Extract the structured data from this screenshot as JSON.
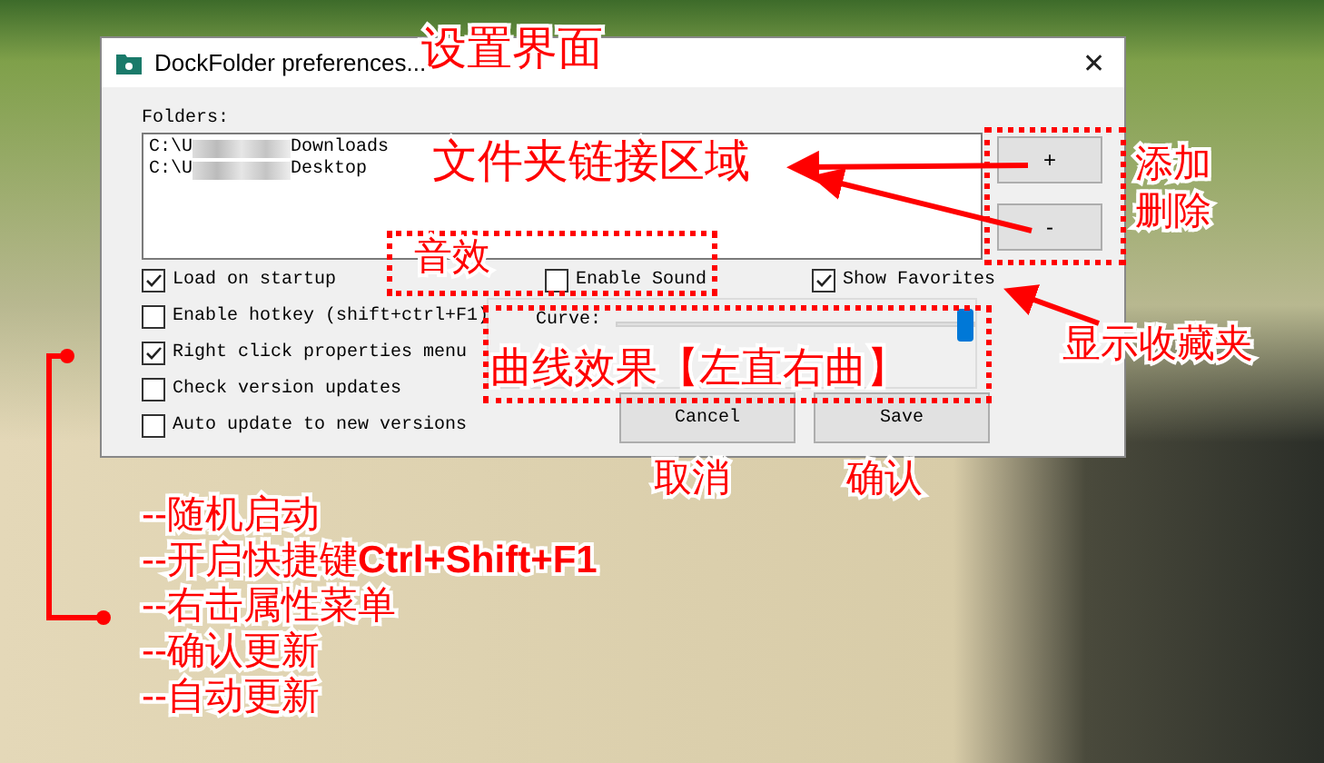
{
  "window": {
    "title": "DockFolder preferences...",
    "close": "✕"
  },
  "folders": {
    "label": "Folders:",
    "items": [
      {
        "prefix": "C:\\U",
        "name": "Downloads"
      },
      {
        "prefix": "C:\\U",
        "name": "Desktop"
      }
    ]
  },
  "side_buttons": [
    "+",
    "-"
  ],
  "options": [
    {
      "label": "Load on startup",
      "checked": true
    },
    {
      "label": "Enable hotkey (shift+ctrl+F1)",
      "checked": false
    },
    {
      "label": "Right click properties menu",
      "checked": true
    },
    {
      "label": "Check version updates",
      "checked": false
    },
    {
      "label": "Auto update to new versions",
      "checked": false
    }
  ],
  "sound": {
    "label": "Enable Sound",
    "checked": false
  },
  "favorites": {
    "label": "Show Favorites",
    "checked": true
  },
  "curve": {
    "label": "Curve:",
    "level": 1
  },
  "buttons": [
    "Cancel",
    "Save"
  ],
  "annotations": {
    "title": "设置界面",
    "folders": "文件夹链接区域",
    "add": "添加",
    "remove": "删除",
    "sound": "音效",
    "favorites": "显示收藏夹",
    "curve": "曲线效果【左直右曲】",
    "cancel": "取消",
    "save": "确认",
    "options": [
      "--随机启动",
      "--开启快捷键**Ctrl+Shift+F1**",
      "--右击属性菜单",
      "--确认更新",
      "--自动更新"
    ]
  }
}
